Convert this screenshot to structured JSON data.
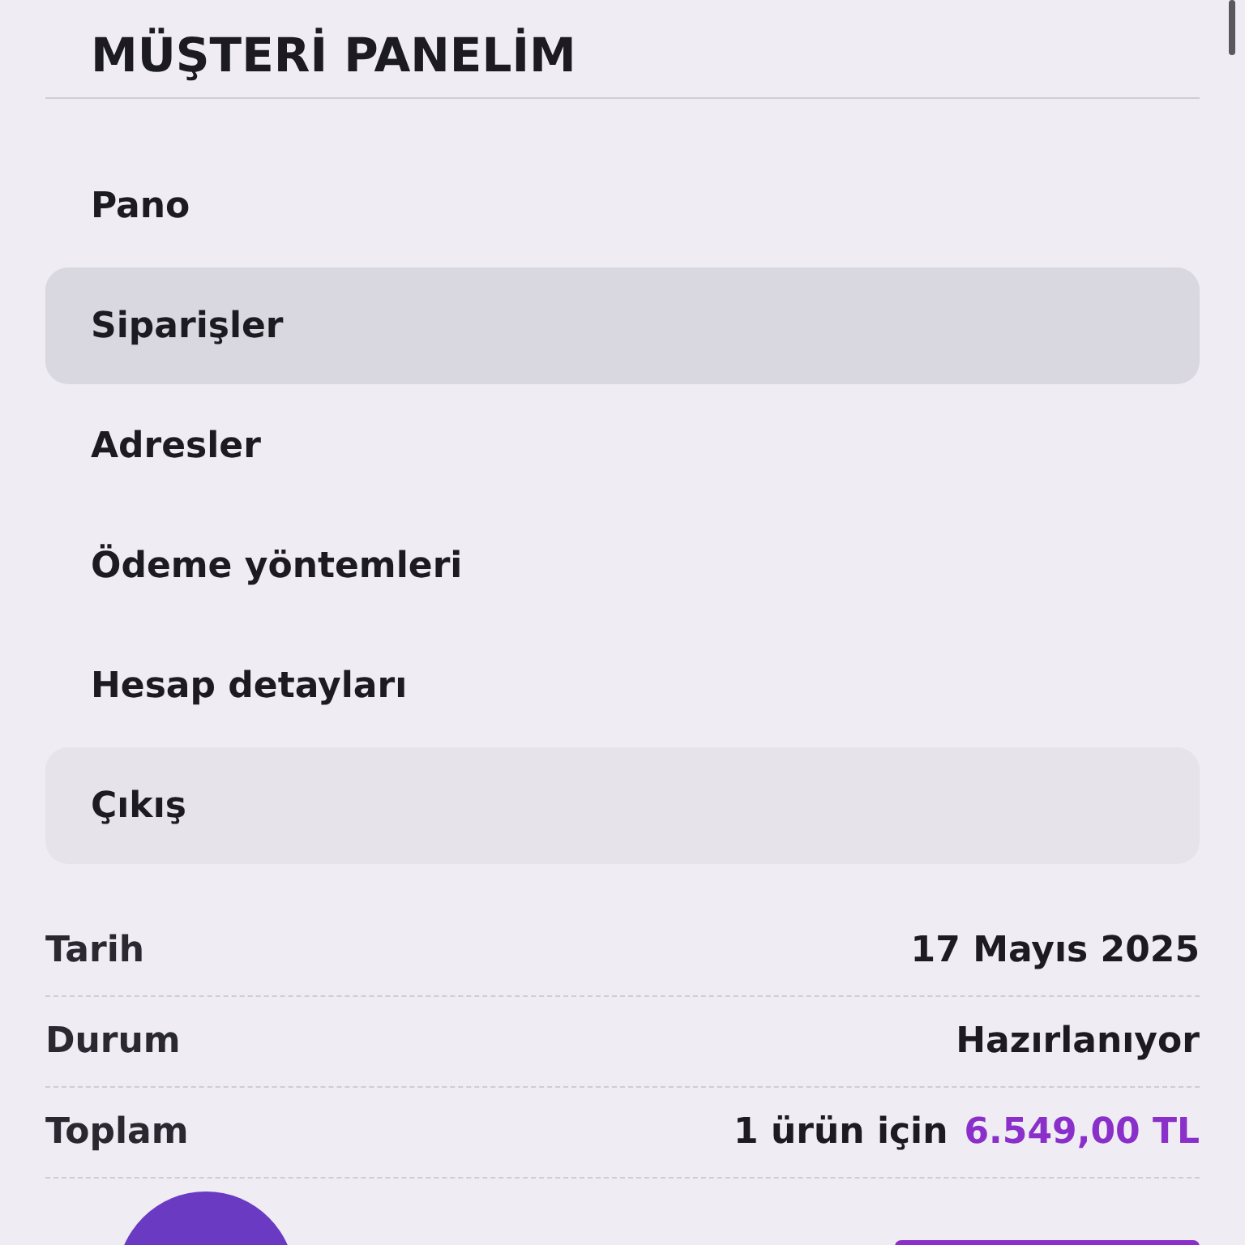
{
  "title": "MÜŞTERİ PANELİM",
  "menu": [
    {
      "label": "Pano",
      "selected": false,
      "kind": "link"
    },
    {
      "label": "Siparişler",
      "selected": true,
      "kind": "link"
    },
    {
      "label": "Adresler",
      "selected": false,
      "kind": "link"
    },
    {
      "label": "Ödeme yöntemleri",
      "selected": false,
      "kind": "link"
    },
    {
      "label": "Hesap detayları",
      "selected": false,
      "kind": "link"
    },
    {
      "label": "Çıkış",
      "selected": false,
      "kind": "logout"
    }
  ],
  "order_summary": [
    {
      "label": "Tarih",
      "value": "17 Mayıs 2025"
    },
    {
      "label": "Durum",
      "value": "Hazırlanıyor"
    },
    {
      "label": "Toplam",
      "value": "1 ürün için",
      "amount": "6.549,00 TL"
    }
  ]
}
